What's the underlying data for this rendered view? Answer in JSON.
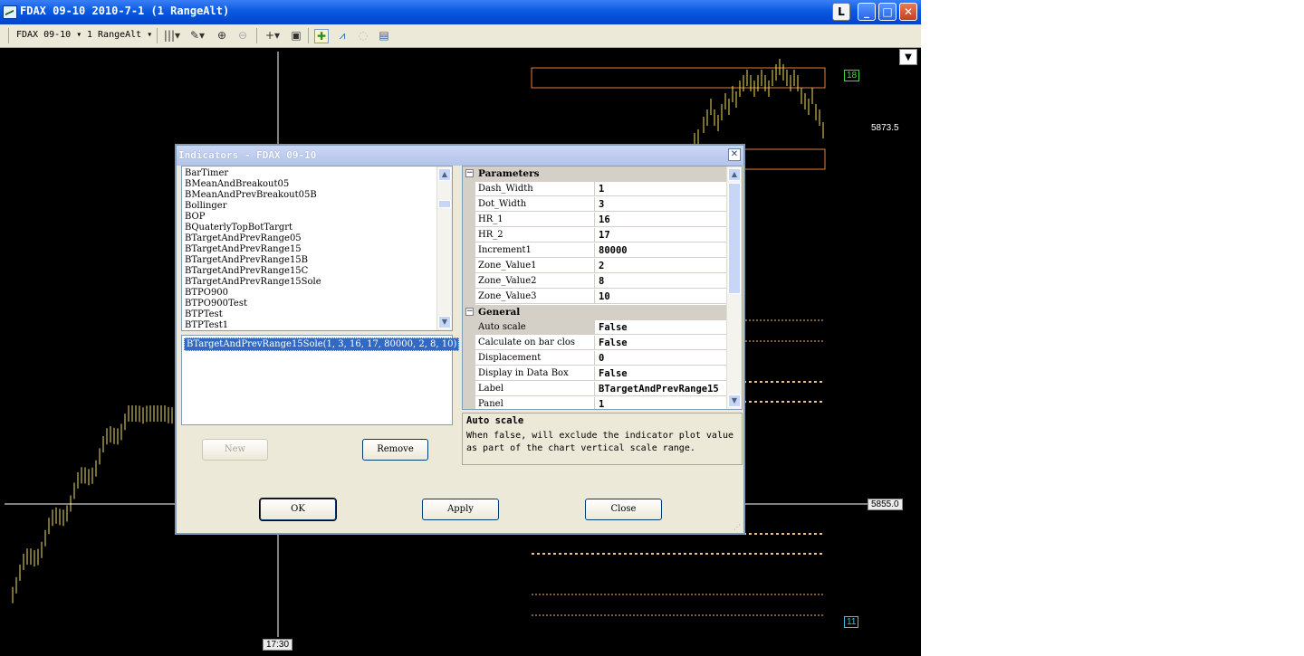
{
  "window": {
    "title": "FDAX 09-10   2010-7-1  (1 RangeAlt)",
    "l_button": "L",
    "minimize": "_",
    "maximize": "□",
    "close": "✕"
  },
  "toolbar": {
    "instrument": "FDAX 09-10 ▾",
    "period": "1 RangeAlt ▾"
  },
  "chart": {
    "price_upper": "5873.5",
    "price_current": "5855.0",
    "bar_count_top": "18",
    "bar_count_bottom": "11",
    "time_label": "17:30",
    "scroll_arrow": "▼",
    "colors": {
      "background": "#000000",
      "bars": "#f0e060",
      "zone": "#e08040",
      "crosshair": "#ffffff",
      "dotted": "#f0c080"
    }
  },
  "dialog": {
    "title": "Indicators - FDAX 09-10",
    "close": "✕",
    "indicators": [
      "BarTimer",
      "BMeanAndBreakout05",
      "BMeanAndPrevBreakout05B",
      "Bollinger",
      "BOP",
      "BQuaterlyTopBotTargrt",
      "BTargetAndPrevRange05",
      "BTargetAndPrevRange15",
      "BTargetAndPrevRange15B",
      "BTargetAndPrevRange15C",
      "BTargetAndPrevRange15Sole",
      "BTPO900",
      "BTPO900Test",
      "BTPTest",
      "BTPTest1"
    ],
    "applied": "BTargetAndPrevRange15Sole(1, 3, 16, 17, 80000, 2, 8, 10)",
    "new_button": "New",
    "remove_button": "Remove",
    "ok_button": "OK",
    "apply_button": "Apply",
    "close_button": "Close",
    "parameters_header": "Parameters",
    "parameters": [
      {
        "name": "Dash_Width",
        "value": "1"
      },
      {
        "name": "Dot_Width",
        "value": "3"
      },
      {
        "name": "HR_1",
        "value": "16"
      },
      {
        "name": "HR_2",
        "value": "17"
      },
      {
        "name": "Increment1",
        "value": "80000"
      },
      {
        "name": "Zone_Value1",
        "value": "2"
      },
      {
        "name": "Zone_Value2",
        "value": "8"
      },
      {
        "name": "Zone_Value3",
        "value": "10"
      }
    ],
    "general_header": "General",
    "general": [
      {
        "name": "Auto scale",
        "value": "False"
      },
      {
        "name": "Calculate on bar clos",
        "value": "False"
      },
      {
        "name": "Displacement",
        "value": "0"
      },
      {
        "name": "Display in Data Box",
        "value": "False"
      },
      {
        "name": "Label",
        "value": "BTargetAndPrevRange15"
      },
      {
        "name": "Panel",
        "value": "1"
      }
    ],
    "desc_title": "Auto scale",
    "desc_text": "When false, will exclude the indicator plot value as part of the chart vertical scale range."
  }
}
